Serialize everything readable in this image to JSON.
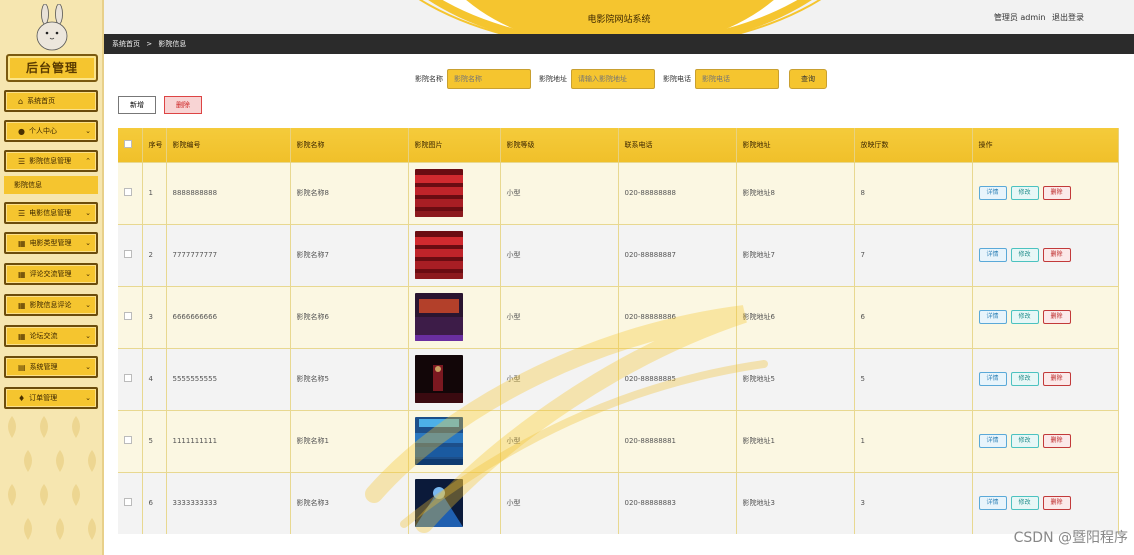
{
  "brand": {
    "title": "后台管理"
  },
  "sidebar": {
    "items": [
      {
        "label": "系统首页",
        "icon": "home-icon",
        "glyph": "⌂"
      },
      {
        "label": "个人中心",
        "icon": "user-icon",
        "glyph": "●"
      },
      {
        "label": "影院信息管理",
        "icon": "list-icon",
        "glyph": "☰"
      },
      {
        "label": "电影信息管理",
        "icon": "list-icon",
        "glyph": "☰"
      },
      {
        "label": "电影类型管理",
        "icon": "grid-icon",
        "glyph": "▦"
      },
      {
        "label": "评论交流管理",
        "icon": "grid-icon",
        "glyph": "▦"
      },
      {
        "label": "影院信息评论",
        "icon": "grid-icon",
        "glyph": "▦"
      },
      {
        "label": "论坛交流",
        "icon": "grid-icon",
        "glyph": "▦"
      },
      {
        "label": "系统管理",
        "icon": "table-icon",
        "glyph": "▤"
      },
      {
        "label": "订单管理",
        "icon": "pin-icon",
        "glyph": "♦"
      }
    ],
    "active_sub": "影院信息"
  },
  "header": {
    "title": "电影院网站系统",
    "user_label": "管理员 admin",
    "logout": "退出登录"
  },
  "breadcrumb": {
    "home": "系统首页",
    "sep": ">",
    "current": "影院信息"
  },
  "search": {
    "f1_label": "影院名称",
    "f1_placeholder": "影院名称",
    "f2_label": "影院地址",
    "f2_placeholder": "请输入影院地址",
    "f3_label": "影院电话",
    "f3_placeholder": "影院电话",
    "button": "查询"
  },
  "actions": {
    "add": "新增",
    "delete": "删除"
  },
  "table": {
    "headers": [
      "",
      "序号",
      "影院编号",
      "影院名称",
      "影院图片",
      "影院等级",
      "联系电话",
      "影院地址",
      "放映厅数",
      "操作"
    ],
    "rows": [
      {
        "idx": "1",
        "code": "8888888888",
        "name": "影院名称8",
        "level": "小型",
        "phone": "020-88888888",
        "addr": "影院地址8",
        "halls": "8",
        "img": "red-seats"
      },
      {
        "idx": "2",
        "code": "7777777777",
        "name": "影院名称7",
        "level": "小型",
        "phone": "020-88888887",
        "addr": "影院地址7",
        "halls": "7",
        "img": "red-seats"
      },
      {
        "idx": "3",
        "code": "6666666666",
        "name": "影院名称6",
        "level": "小型",
        "phone": "020-88888886",
        "addr": "影院地址6",
        "halls": "6",
        "img": "dark-hall"
      },
      {
        "idx": "4",
        "code": "5555555555",
        "name": "影院名称5",
        "level": "小型",
        "phone": "020-88888885",
        "addr": "影院地址5",
        "halls": "5",
        "img": "stage"
      },
      {
        "idx": "5",
        "code": "1111111111",
        "name": "影院名称1",
        "level": "小型",
        "phone": "020-88888881",
        "addr": "影院地址1",
        "halls": "1",
        "img": "blue-hall"
      },
      {
        "idx": "6",
        "code": "3333333333",
        "name": "影院名称3",
        "level": "小型",
        "phone": "020-88888883",
        "addr": "影院地址3",
        "halls": "3",
        "img": "blue-light"
      }
    ],
    "row_buttons": {
      "detail": "详情",
      "edit": "修改",
      "delete": "删除"
    }
  },
  "watermark": "CSDN @暨阳程序"
}
